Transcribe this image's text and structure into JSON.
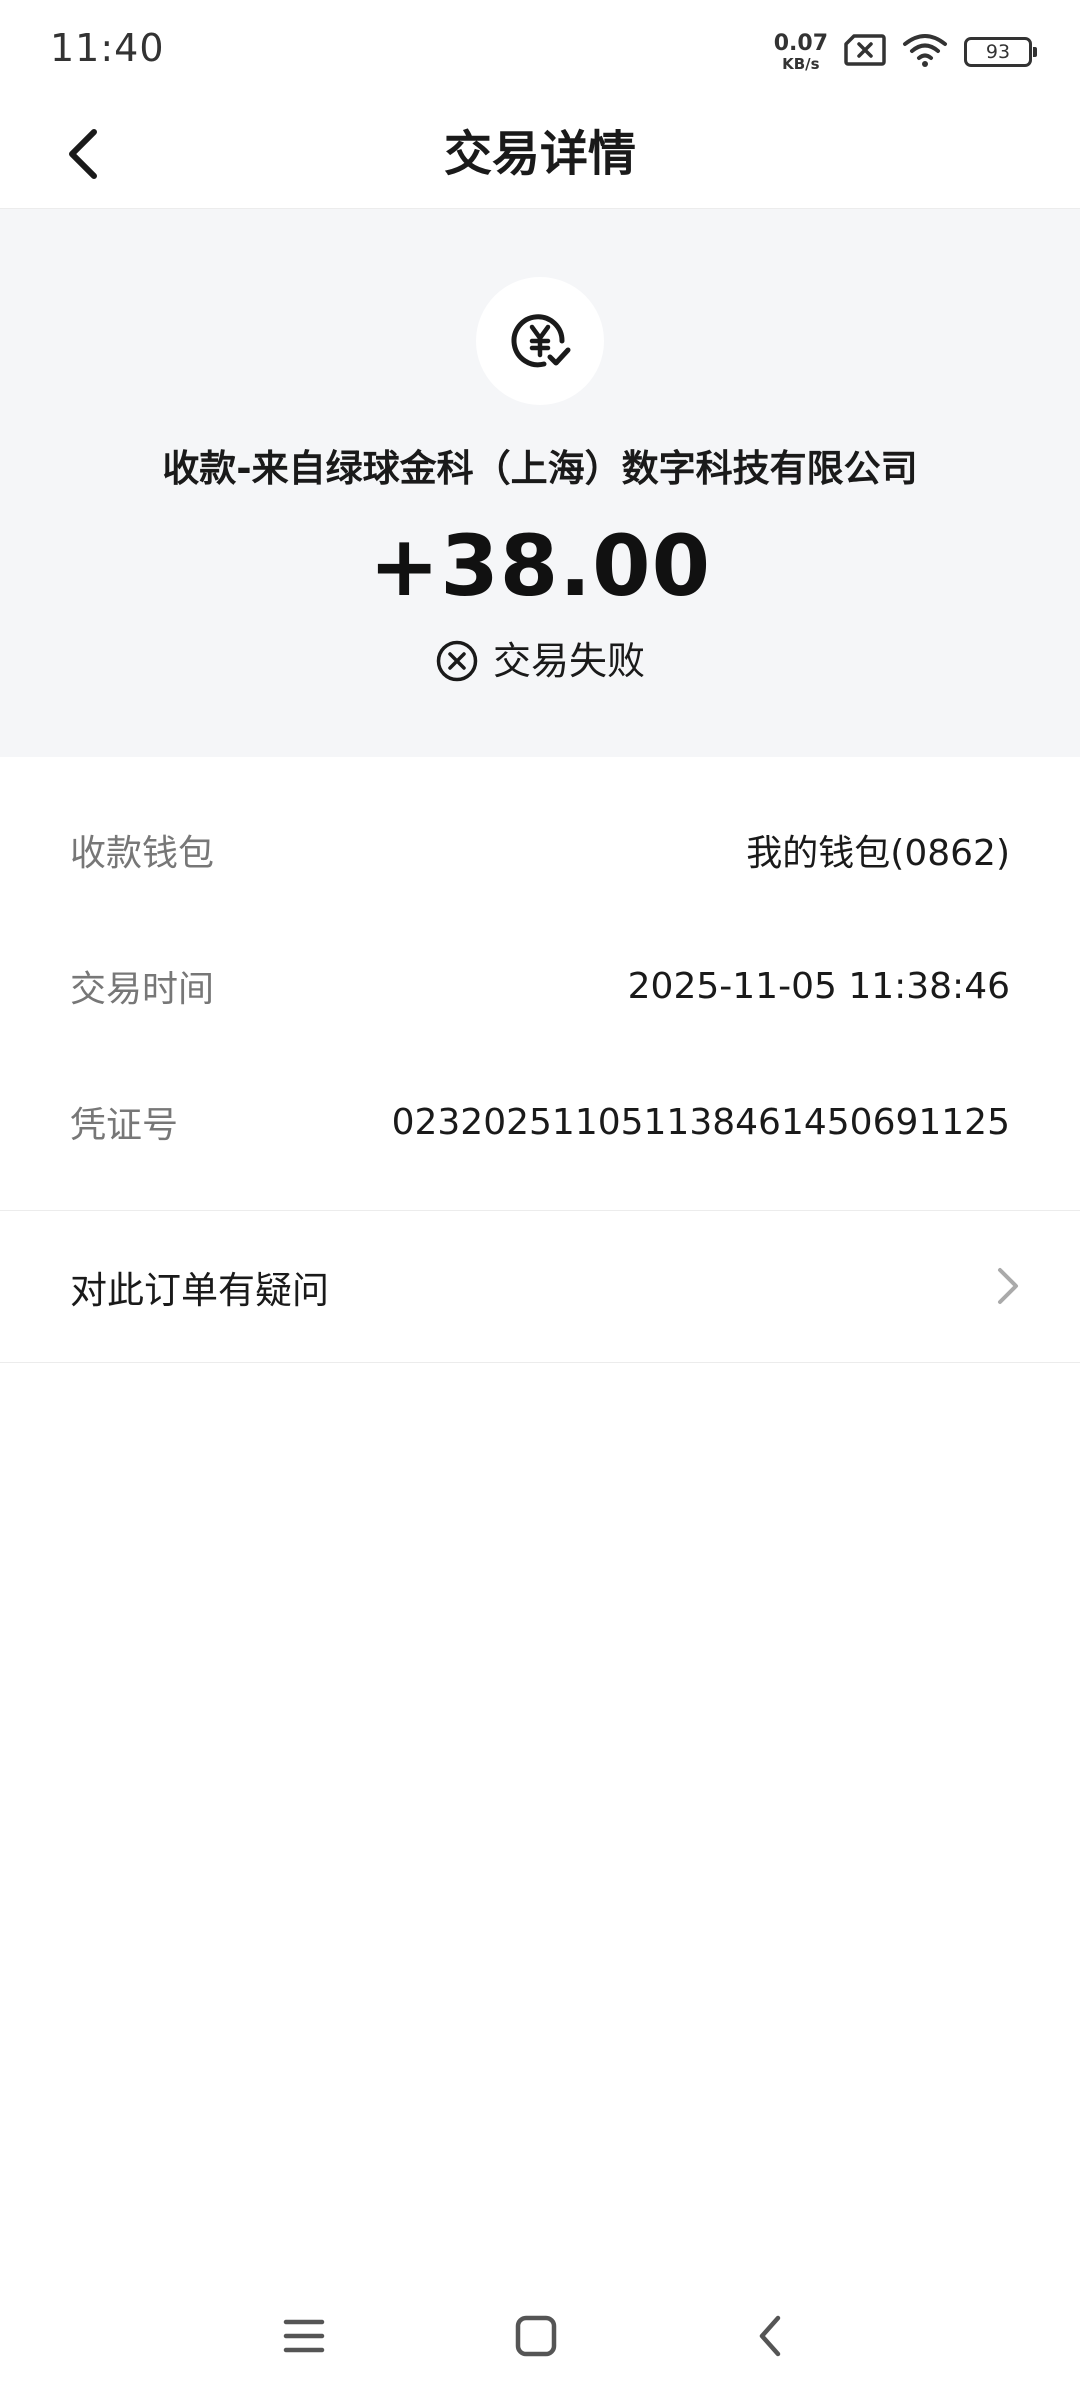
{
  "status_bar": {
    "time": "11:40",
    "net_speed_value": "0.07",
    "net_speed_unit": "KB/s",
    "battery": "93"
  },
  "nav": {
    "title": "交易详情"
  },
  "transaction": {
    "payer": "收款-来自绿球金科（上海）数字科技有限公司",
    "amount": "+38.00",
    "status": "交易失败"
  },
  "details": [
    {
      "label": "收款钱包",
      "value": "我的钱包(0862)"
    },
    {
      "label": "交易时间",
      "value": "2025-11-05 11:38:46"
    },
    {
      "label": "凭证号",
      "value": "0232025110511384614506911​25"
    }
  ],
  "question": {
    "label": "对此订单有疑问"
  },
  "colors": {
    "header_bg": "#f5f6f8",
    "label_gray": "#777777",
    "text_dark": "#1a1a1a"
  }
}
